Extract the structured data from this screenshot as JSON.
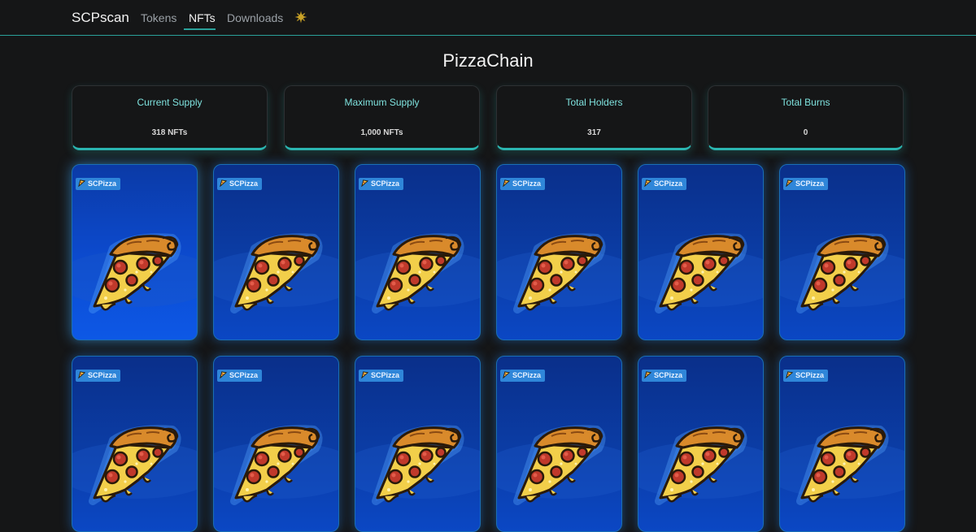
{
  "nav": {
    "brand": "SCPscan",
    "items": [
      {
        "label": "Tokens",
        "active": false
      },
      {
        "label": "NFTs",
        "active": true
      },
      {
        "label": "Downloads",
        "active": false
      }
    ],
    "theme_icon": "sun-icon",
    "accent_color": "#2aa19a"
  },
  "page": {
    "title": "PizzaChain"
  },
  "stats": [
    {
      "label": "Current Supply",
      "value": "318 NFTs"
    },
    {
      "label": "Maximum Supply",
      "value": "1,000 NFTs"
    },
    {
      "label": "Total Holders",
      "value": "317"
    },
    {
      "label": "Total Burns",
      "value": "0"
    }
  ],
  "nfts": [
    {
      "badge": "SCPizza",
      "image": "pizza-slice"
    },
    {
      "badge": "SCPizza",
      "image": "pizza-slice"
    },
    {
      "badge": "SCPizza",
      "image": "pizza-slice"
    },
    {
      "badge": "SCPizza",
      "image": "pizza-slice"
    },
    {
      "badge": "SCPizza",
      "image": "pizza-slice"
    },
    {
      "badge": "SCPizza",
      "image": "pizza-slice"
    },
    {
      "badge": "SCPizza",
      "image": "pizza-slice"
    },
    {
      "badge": "SCPizza",
      "image": "pizza-slice"
    },
    {
      "badge": "SCPizza",
      "image": "pizza-slice"
    },
    {
      "badge": "SCPizza",
      "image": "pizza-slice"
    },
    {
      "badge": "SCPizza",
      "image": "pizza-slice"
    },
    {
      "badge": "SCPizza",
      "image": "pizza-slice"
    }
  ]
}
